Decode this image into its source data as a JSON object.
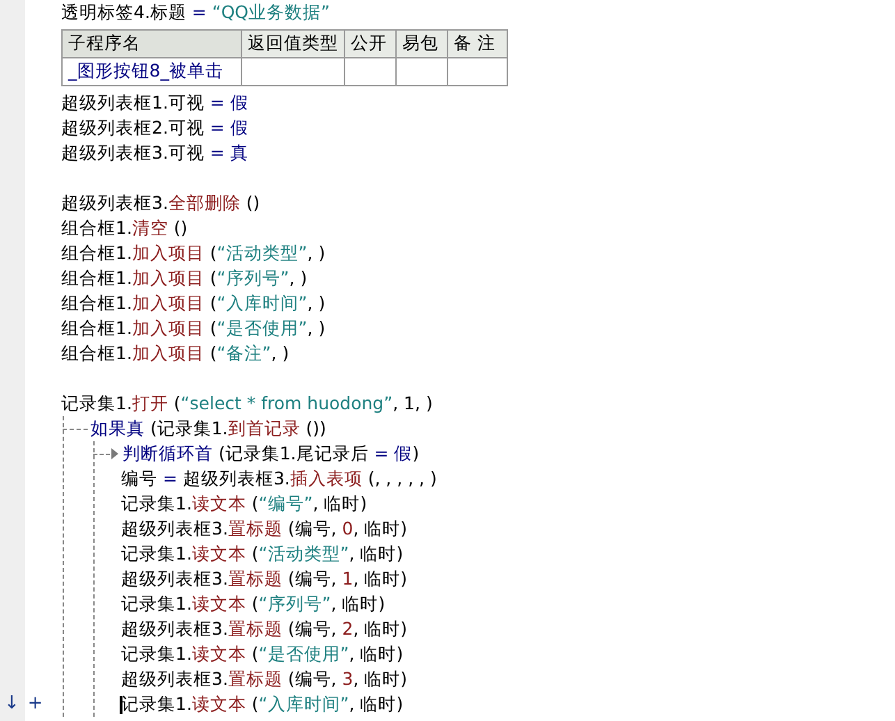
{
  "lines": [
    {
      "kind": "code",
      "tokens": [
        {
          "t": "透明标签4.标题 ",
          "kind": "plain"
        },
        {
          "t": "=",
          "kind": "op"
        },
        {
          "t": " “QQ业务数据”",
          "kind": "string"
        }
      ]
    },
    {
      "kind": "table",
      "columns": [
        "子程序名",
        "返回值类型",
        "公开",
        "易包",
        "备 注"
      ],
      "rows": [
        [
          "_图形按钮8_被单击"
        ]
      ]
    },
    {
      "kind": "code",
      "tokens": [
        {
          "t": "超级列表框1.可视 ",
          "kind": "plain"
        },
        {
          "t": "= 假",
          "kind": "op"
        }
      ]
    },
    {
      "kind": "code",
      "tokens": [
        {
          "t": "超级列表框2.可视 ",
          "kind": "plain"
        },
        {
          "t": "= 假",
          "kind": "op"
        }
      ]
    },
    {
      "kind": "code",
      "tokens": [
        {
          "t": "超级列表框3.可视 ",
          "kind": "plain"
        },
        {
          "t": "= 真",
          "kind": "op"
        }
      ]
    },
    {
      "kind": "blank"
    },
    {
      "kind": "code",
      "tokens": [
        {
          "t": "超级列表框3.",
          "kind": "plain"
        },
        {
          "t": "全部删除",
          "kind": "method"
        },
        {
          "t": " ()",
          "kind": "plain"
        }
      ]
    },
    {
      "kind": "code",
      "tokens": [
        {
          "t": "组合框1.",
          "kind": "plain"
        },
        {
          "t": "清空",
          "kind": "method"
        },
        {
          "t": " ()",
          "kind": "plain"
        }
      ]
    },
    {
      "kind": "code",
      "tokens": [
        {
          "t": "组合框1.",
          "kind": "plain"
        },
        {
          "t": "加入项目",
          "kind": "method"
        },
        {
          "t": " (",
          "kind": "plain"
        },
        {
          "t": "“活动类型”",
          "kind": "string"
        },
        {
          "t": ", )",
          "kind": "plain"
        }
      ]
    },
    {
      "kind": "code",
      "tokens": [
        {
          "t": "组合框1.",
          "kind": "plain"
        },
        {
          "t": "加入项目",
          "kind": "method"
        },
        {
          "t": " (",
          "kind": "plain"
        },
        {
          "t": "“序列号”",
          "kind": "string"
        },
        {
          "t": ", )",
          "kind": "plain"
        }
      ]
    },
    {
      "kind": "code",
      "tokens": [
        {
          "t": "组合框1.",
          "kind": "plain"
        },
        {
          "t": "加入项目",
          "kind": "method"
        },
        {
          "t": " (",
          "kind": "plain"
        },
        {
          "t": "“入库时间”",
          "kind": "string"
        },
        {
          "t": ", )",
          "kind": "plain"
        }
      ]
    },
    {
      "kind": "code",
      "tokens": [
        {
          "t": "组合框1.",
          "kind": "plain"
        },
        {
          "t": "加入项目",
          "kind": "method"
        },
        {
          "t": " (",
          "kind": "plain"
        },
        {
          "t": "“是否使用”",
          "kind": "string"
        },
        {
          "t": ", )",
          "kind": "plain"
        }
      ]
    },
    {
      "kind": "code",
      "tokens": [
        {
          "t": "组合框1.",
          "kind": "plain"
        },
        {
          "t": "加入项目",
          "kind": "method"
        },
        {
          "t": " (",
          "kind": "plain"
        },
        {
          "t": "“备注”",
          "kind": "string"
        },
        {
          "t": ", )",
          "kind": "plain"
        }
      ]
    },
    {
      "kind": "blank"
    },
    {
      "kind": "code",
      "tokens": [
        {
          "t": "记录集1.",
          "kind": "plain"
        },
        {
          "t": "打开",
          "kind": "method"
        },
        {
          "t": " (",
          "kind": "plain"
        },
        {
          "t": "“select * from huodong”",
          "kind": "string"
        },
        {
          "t": ", 1, )",
          "kind": "plain"
        }
      ]
    },
    {
      "kind": "block",
      "head": [
        {
          "t": "如果真",
          "kind": "keyword"
        },
        {
          "t": " (记录集1.",
          "kind": "plain"
        },
        {
          "t": "到首记录",
          "kind": "method"
        },
        {
          "t": " ())",
          "kind": "plain"
        }
      ],
      "children": [
        {
          "kind": "block",
          "head": [
            {
              "t": "判断循环首",
              "kind": "keyword"
            },
            {
              "t": " (记录集1.尾记录后 ",
              "kind": "plain"
            },
            {
              "t": "= 假",
              "kind": "op"
            },
            {
              "t": ")",
              "kind": "plain"
            }
          ],
          "children": [
            {
              "kind": "code",
              "tokens": [
                {
                  "t": "编号 ",
                  "kind": "plain"
                },
                {
                  "t": "=",
                  "kind": "op"
                },
                {
                  "t": " 超级列表框3.",
                  "kind": "plain"
                },
                {
                  "t": "插入表项",
                  "kind": "method"
                },
                {
                  "t": " (, , , , , )",
                  "kind": "plain"
                }
              ]
            },
            {
              "kind": "code",
              "tokens": [
                {
                  "t": "记录集1.",
                  "kind": "plain"
                },
                {
                  "t": "读文本",
                  "kind": "method"
                },
                {
                  "t": " (",
                  "kind": "plain"
                },
                {
                  "t": "“编号”",
                  "kind": "string"
                },
                {
                  "t": ", 临时)",
                  "kind": "plain"
                }
              ]
            },
            {
              "kind": "code",
              "tokens": [
                {
                  "t": "超级列表框3.",
                  "kind": "plain"
                },
                {
                  "t": "置标题",
                  "kind": "method"
                },
                {
                  "t": " (编号, ",
                  "kind": "plain"
                },
                {
                  "t": "0",
                  "kind": "number"
                },
                {
                  "t": ", 临时)",
                  "kind": "plain"
                }
              ]
            },
            {
              "kind": "code",
              "tokens": [
                {
                  "t": "记录集1.",
                  "kind": "plain"
                },
                {
                  "t": "读文本",
                  "kind": "method"
                },
                {
                  "t": " (",
                  "kind": "plain"
                },
                {
                  "t": "“活动类型”",
                  "kind": "string"
                },
                {
                  "t": ", 临时)",
                  "kind": "plain"
                }
              ]
            },
            {
              "kind": "code",
              "tokens": [
                {
                  "t": "超级列表框3.",
                  "kind": "plain"
                },
                {
                  "t": "置标题",
                  "kind": "method"
                },
                {
                  "t": " (编号, ",
                  "kind": "plain"
                },
                {
                  "t": "1",
                  "kind": "number"
                },
                {
                  "t": ", 临时)",
                  "kind": "plain"
                }
              ]
            },
            {
              "kind": "code",
              "tokens": [
                {
                  "t": "记录集1.",
                  "kind": "plain"
                },
                {
                  "t": "读文本",
                  "kind": "method"
                },
                {
                  "t": " (",
                  "kind": "plain"
                },
                {
                  "t": "“序列号”",
                  "kind": "string"
                },
                {
                  "t": ", 临时)",
                  "kind": "plain"
                }
              ]
            },
            {
              "kind": "code",
              "tokens": [
                {
                  "t": "超级列表框3.",
                  "kind": "plain"
                },
                {
                  "t": "置标题",
                  "kind": "method"
                },
                {
                  "t": " (编号, ",
                  "kind": "plain"
                },
                {
                  "t": "2",
                  "kind": "number"
                },
                {
                  "t": ", 临时)",
                  "kind": "plain"
                }
              ]
            },
            {
              "kind": "code",
              "tokens": [
                {
                  "t": "记录集1.",
                  "kind": "plain"
                },
                {
                  "t": "读文本",
                  "kind": "method"
                },
                {
                  "t": " (",
                  "kind": "plain"
                },
                {
                  "t": "“是否使用”",
                  "kind": "string"
                },
                {
                  "t": ", 临时)",
                  "kind": "plain"
                }
              ]
            },
            {
              "kind": "code",
              "tokens": [
                {
                  "t": "超级列表框3.",
                  "kind": "plain"
                },
                {
                  "t": "置标题",
                  "kind": "method"
                },
                {
                  "t": " (编号, ",
                  "kind": "plain"
                },
                {
                  "t": "3",
                  "kind": "number"
                },
                {
                  "t": ", 临时)",
                  "kind": "plain"
                }
              ]
            },
            {
              "kind": "code",
              "cursor": true,
              "gutter": [
                "↓",
                "+"
              ],
              "tokens": [
                {
                  "t": "记录集1.",
                  "kind": "plain"
                },
                {
                  "t": "读文本",
                  "kind": "method"
                },
                {
                  "t": " (",
                  "kind": "plain"
                },
                {
                  "t": "“入库时间”",
                  "kind": "string"
                },
                {
                  "t": ", 临时)",
                  "kind": "plain"
                }
              ]
            }
          ]
        }
      ]
    }
  ]
}
